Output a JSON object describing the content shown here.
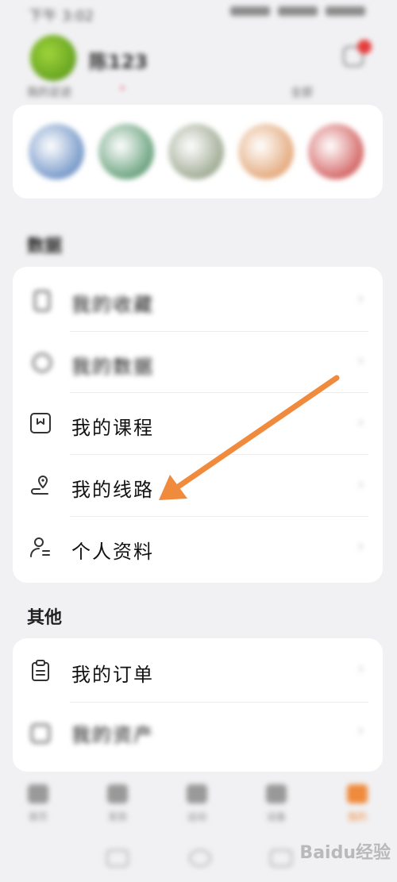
{
  "status_bar": {
    "time": "下午 3:02"
  },
  "profile": {
    "username": "陈123"
  },
  "recent": {
    "label": "我的足迹",
    "mark": "•",
    "more": "全部"
  },
  "recent_circles": [
    {
      "color": "#3f6fb3"
    },
    {
      "color": "#2e7d4a"
    },
    {
      "color": "#7a8a6a"
    },
    {
      "color": "#d9884a"
    },
    {
      "color": "#c42a2a"
    }
  ],
  "section_data": {
    "title": "数据",
    "items": [
      {
        "label": "我的收藏",
        "icon": "bookmark-icon",
        "blurred": true
      },
      {
        "label": "我的数据",
        "icon": "chart-icon",
        "blurred": true
      },
      {
        "label": "我的课程",
        "icon": "course-icon",
        "blurred": false
      },
      {
        "label": "我的线路",
        "icon": "route-icon",
        "blurred": false
      },
      {
        "label": "个人资料",
        "icon": "person-icon",
        "blurred": false
      }
    ]
  },
  "section_other": {
    "title": "其他",
    "items": [
      {
        "label": "我的订单",
        "icon": "order-icon",
        "blurred": false
      },
      {
        "label": "我的资产",
        "icon": "wallet-icon",
        "blurred": true
      }
    ]
  },
  "bottom_nav": [
    {
      "label": "首页"
    },
    {
      "label": "发现"
    },
    {
      "label": "运动"
    },
    {
      "label": "设备"
    },
    {
      "label": "我的"
    }
  ],
  "chevron": "›",
  "arrow_color": "#f08a3c",
  "watermark": "Baidu经验"
}
